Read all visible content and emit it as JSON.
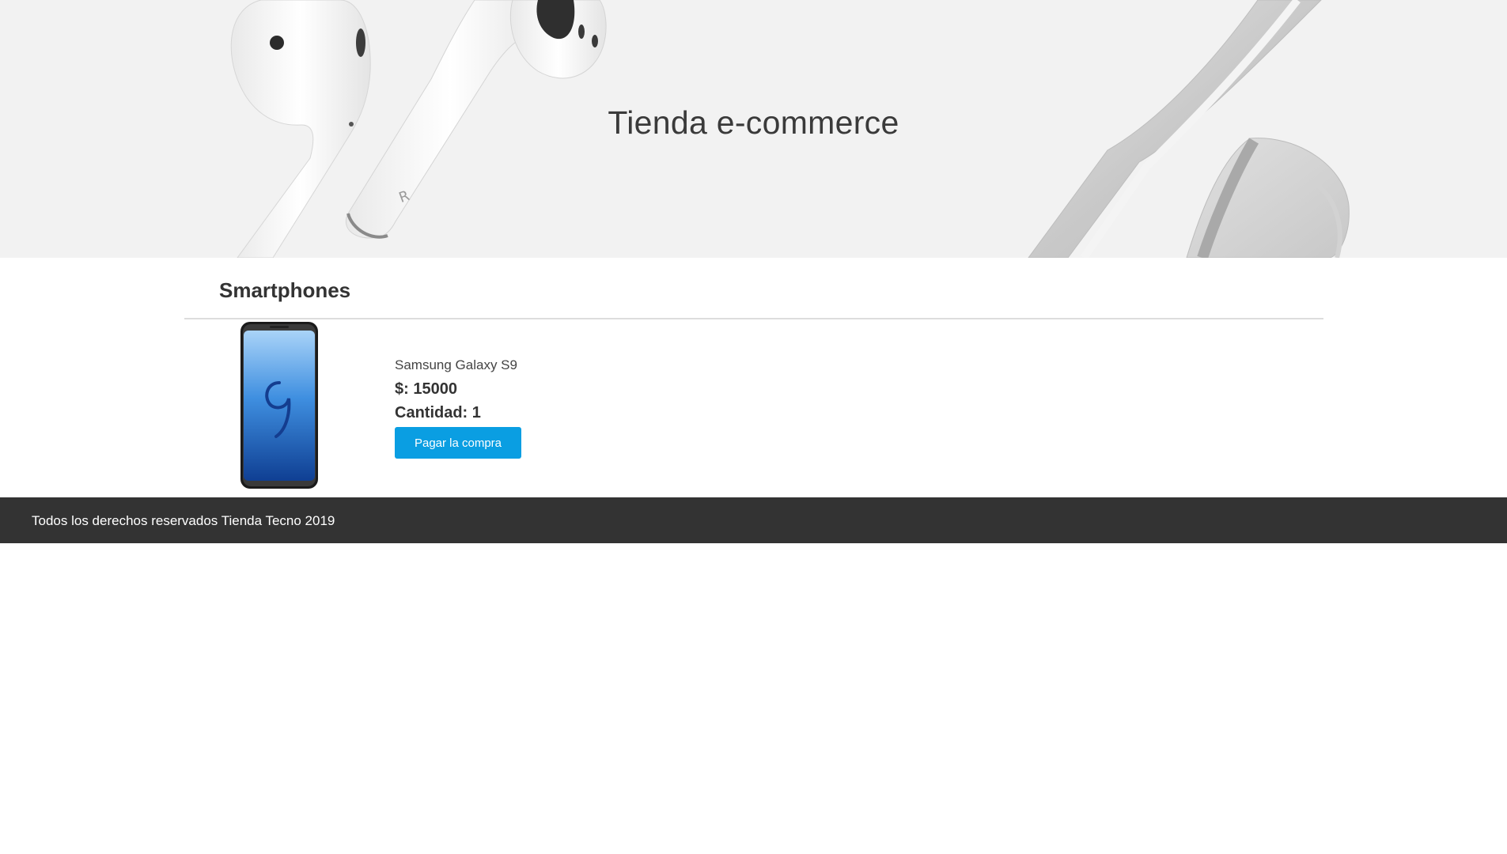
{
  "hero": {
    "title": "Tienda e-commerce",
    "background_color": "#f2f2f2",
    "decoration": [
      "earbuds-image",
      "headphones-image"
    ]
  },
  "section": {
    "title": "Smartphones"
  },
  "products": [
    {
      "image": "smartphone-image",
      "name": "Samsung Galaxy S9",
      "price_label": "$: 15000",
      "quantity_label": "Cantidad: 1",
      "button_label": "Pagar la compra"
    }
  ],
  "footer": {
    "text": "Todos los derechos reservados Tienda Tecno 2019",
    "background_color": "#333333"
  },
  "colors": {
    "accent": "#0a9ee2",
    "text": "#333333"
  }
}
